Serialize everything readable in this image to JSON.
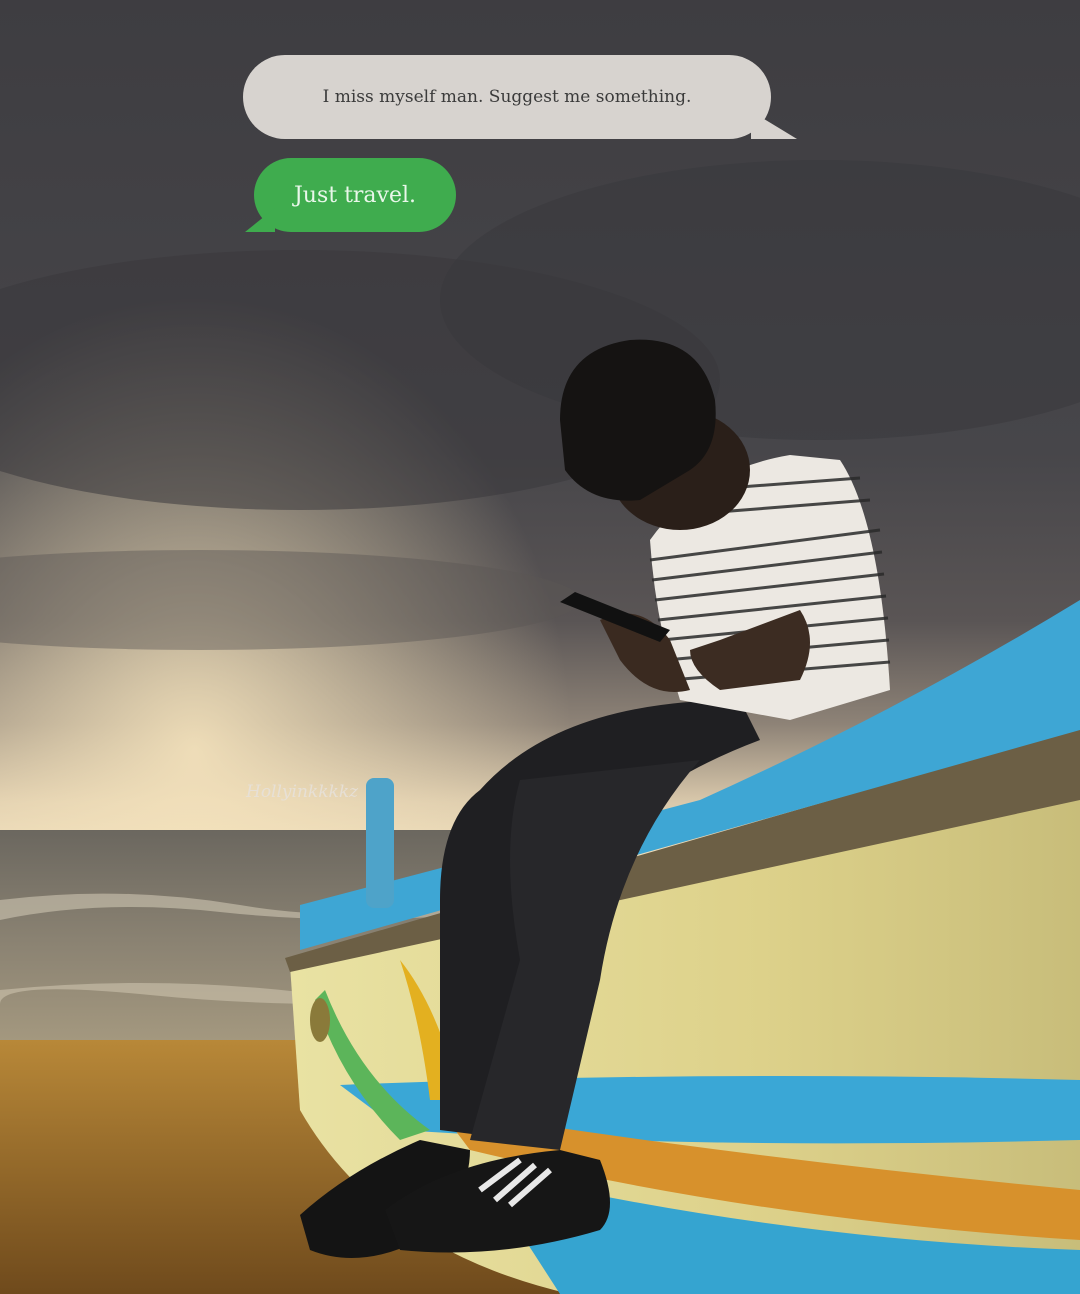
{
  "messages": {
    "received": "I miss myself man. Suggest me something.",
    "sent": "Just travel."
  },
  "watermark": "Hollyinkkkkz",
  "colors": {
    "received_bubble": "#d7d3cf",
    "sent_bubble": "#3fac4e",
    "sky_dark": "#3b3a3e",
    "horizon_glow": "#f0dcb6",
    "sand": "#b07a2e",
    "boat_blue": "#3aa7d6",
    "boat_yellow": "#e7dd8a"
  }
}
